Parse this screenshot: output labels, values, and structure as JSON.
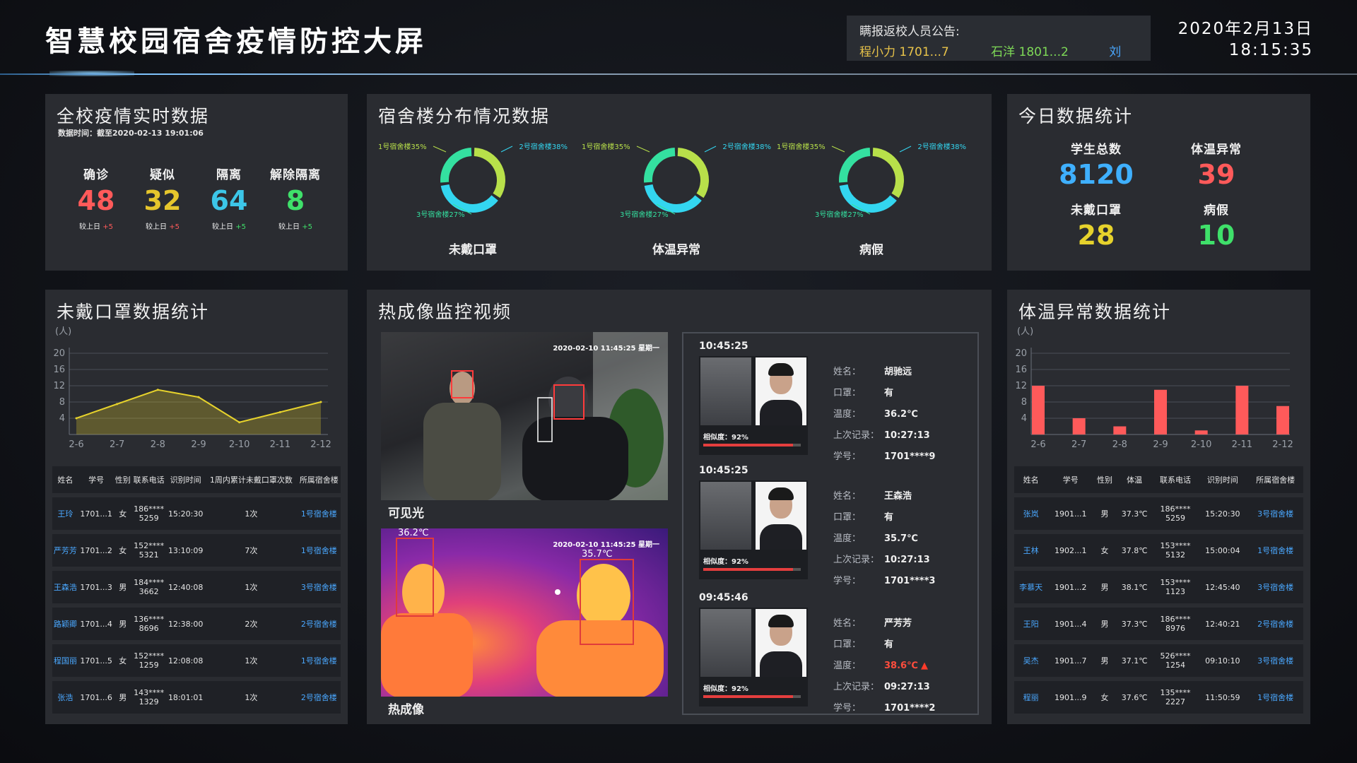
{
  "header": {
    "title": "智慧校园宿舍疫情防控大屏",
    "notice_title": "瞒报返校人员公告:",
    "notice_names": [
      "程小力 1701...7",
      "石洋 1801...2",
      "刘"
    ],
    "date": "2020年2月13日",
    "time": "18:15:35"
  },
  "panel_overview": {
    "title": "全校疫情实时数据",
    "subtitle": "数据时间：截至2020-02-13 19:01:06",
    "stats": [
      {
        "label": "确诊",
        "value": "48",
        "compare": "较上日",
        "delta": "+5",
        "color": "#ff5a5a"
      },
      {
        "label": "疑似",
        "value": "32",
        "compare": "较上日",
        "delta": "+5",
        "color": "#e6c62c"
      },
      {
        "label": "隔离",
        "value": "64",
        "compare": "较上日",
        "delta": "+5",
        "color": "#3cc6e8"
      },
      {
        "label": "解除隔离",
        "value": "8",
        "compare": "较上日",
        "delta": "+5",
        "color": "#3fe06a"
      }
    ]
  },
  "panel_dorm": {
    "title": "宿舍楼分布情况数据",
    "donuts": [
      {
        "label": "未戴口罩",
        "slices": [
          {
            "name": "1号宿舍楼35%",
            "value": 35,
            "color": "#b8e04a"
          },
          {
            "name": "2号宿舍楼38%",
            "value": 38,
            "color": "#33d6f0"
          },
          {
            "name": "3号宿舍楼27%",
            "value": 27,
            "color": "#34e0a0"
          }
        ]
      },
      {
        "label": "体温异常",
        "slices": [
          {
            "name": "1号宿舍楼35%",
            "value": 35,
            "color": "#b8e04a"
          },
          {
            "name": "2号宿舍楼38%",
            "value": 38,
            "color": "#33d6f0"
          },
          {
            "name": "3号宿舍楼27%",
            "value": 27,
            "color": "#34e0a0"
          }
        ]
      },
      {
        "label": "病假",
        "slices": [
          {
            "name": "1号宿舍楼35%",
            "value": 35,
            "color": "#b8e04a"
          },
          {
            "name": "2号宿舍楼38%",
            "value": 38,
            "color": "#33d6f0"
          },
          {
            "name": "3号宿舍楼27%",
            "value": 27,
            "color": "#34e0a0"
          }
        ]
      }
    ]
  },
  "panel_today": {
    "title": "今日数据统计",
    "items": [
      {
        "label": "学生总数",
        "value": "8120",
        "color": "#3fb0ff"
      },
      {
        "label": "体温异常",
        "value": "39",
        "color": "#ff5a5a"
      },
      {
        "label": "未戴口罩",
        "value": "28",
        "color": "#e6d22c"
      },
      {
        "label": "病假",
        "value": "10",
        "color": "#3fe06a"
      }
    ]
  },
  "panel_mask": {
    "title": "未戴口罩数据统计",
    "unit": "(人)",
    "chart_data": {
      "type": "area",
      "categories": [
        "2-6",
        "2-7",
        "2-8",
        "2-9",
        "2-10",
        "2-11",
        "2-12"
      ],
      "values": [
        4,
        7.5,
        11,
        9.2,
        3,
        5.5,
        8
      ],
      "ylim": [
        0,
        20
      ],
      "yticks": [
        4,
        8,
        12,
        16,
        20
      ],
      "color": "#e6d22c"
    },
    "table": {
      "headers": [
        "姓名",
        "学号",
        "性别",
        "联系电话",
        "识别时间",
        "1周内累计未戴口罩次数",
        "所属宿舍楼"
      ],
      "rows": [
        [
          "王玲",
          "1701...1",
          "女",
          "186**** 5259",
          "15:20:30",
          "1次",
          "1号宿舍楼"
        ],
        [
          "严芳芳",
          "1701...2",
          "女",
          "152**** 5321",
          "13:10:09",
          "7次",
          "1号宿舍楼"
        ],
        [
          "王森浩",
          "1701...3",
          "男",
          "184**** 3662",
          "12:40:08",
          "1次",
          "3号宿舍楼"
        ],
        [
          "路颖卿",
          "1701...4",
          "男",
          "136**** 8696",
          "12:38:00",
          "2次",
          "2号宿舍楼"
        ],
        [
          "程国丽",
          "1701...5",
          "女",
          "152**** 1259",
          "12:08:08",
          "1次",
          "1号宿舍楼"
        ],
        [
          "张浩",
          "1701...6",
          "男",
          "143**** 1329",
          "18:01:01",
          "1次",
          "2号宿舍楼"
        ]
      ]
    }
  },
  "panel_video": {
    "title": "热成像监控视频",
    "visible_caption": "可见光",
    "thermal_caption": "热成像",
    "timestamp": "2020-02-10 11:45:25 星期一",
    "temp1": "36.2℃",
    "temp2": "35.7℃",
    "records": [
      {
        "time": "10:45:25",
        "similarity": "相似度：92%",
        "sim_pct": 0.92,
        "name_k": "姓名：",
        "name": "胡驰远",
        "mask_k": "口罩：",
        "mask": "有",
        "temp_k": "温度：",
        "temp": "36.2℃",
        "hot": false,
        "last_k": "上次记录：",
        "last": "10:27:13",
        "id_k": "学号：",
        "id": "1701****9"
      },
      {
        "time": "10:45:25",
        "similarity": "相似度：92%",
        "sim_pct": 0.92,
        "name_k": "姓名：",
        "name": "王森浩",
        "mask_k": "口罩：",
        "mask": "有",
        "temp_k": "温度：",
        "temp": "35.7℃",
        "hot": false,
        "last_k": "上次记录：",
        "last": "10:27:13",
        "id_k": "学号：",
        "id": "1701****3"
      },
      {
        "time": "09:45:46",
        "similarity": "相似度：92%",
        "sim_pct": 0.92,
        "name_k": "姓名：",
        "name": "严芳芳",
        "mask_k": "口罩：",
        "mask": "有",
        "temp_k": "温度：",
        "temp": "38.6℃",
        "hot": true,
        "last_k": "上次记录：",
        "last": "09:27:13",
        "id_k": "学号：",
        "id": "1701****2"
      }
    ]
  },
  "panel_temp": {
    "title": "体温异常数据统计",
    "unit": "(人)",
    "chart_data": {
      "type": "bar",
      "categories": [
        "2-6",
        "2-7",
        "2-8",
        "2-9",
        "2-10",
        "2-11",
        "2-12"
      ],
      "values": [
        12,
        4,
        2,
        11,
        1,
        12,
        7
      ],
      "ylim": [
        0,
        20
      ],
      "yticks": [
        4,
        8,
        12,
        16,
        20
      ],
      "color": "#ff5a5a"
    },
    "table": {
      "headers": [
        "姓名",
        "学号",
        "性别",
        "体温",
        "联系电话",
        "识别时间",
        "所属宿舍楼"
      ],
      "rows": [
        [
          "张岚",
          "1901...1",
          "男",
          "37.3℃",
          "186**** 5259",
          "15:20:30",
          "3号宿舍楼"
        ],
        [
          "王林",
          "1902...1",
          "女",
          "37.8℃",
          "153**** 5132",
          "15:00:04",
          "1号宿舍楼"
        ],
        [
          "李慕天",
          "1901...2",
          "男",
          "38.1℃",
          "153**** 1123",
          "12:45:40",
          "3号宿舍楼"
        ],
        [
          "王阳",
          "1901...4",
          "男",
          "37.3℃",
          "186**** 8976",
          "12:40:21",
          "2号宿舍楼"
        ],
        [
          "吴杰",
          "1901...7",
          "男",
          "37.1℃",
          "526**** 1254",
          "09:10:10",
          "3号宿舍楼"
        ],
        [
          "程丽",
          "1901...9",
          "女",
          "37.6℃",
          "135**** 2227",
          "11:50:59",
          "1号宿舍楼"
        ]
      ]
    }
  }
}
